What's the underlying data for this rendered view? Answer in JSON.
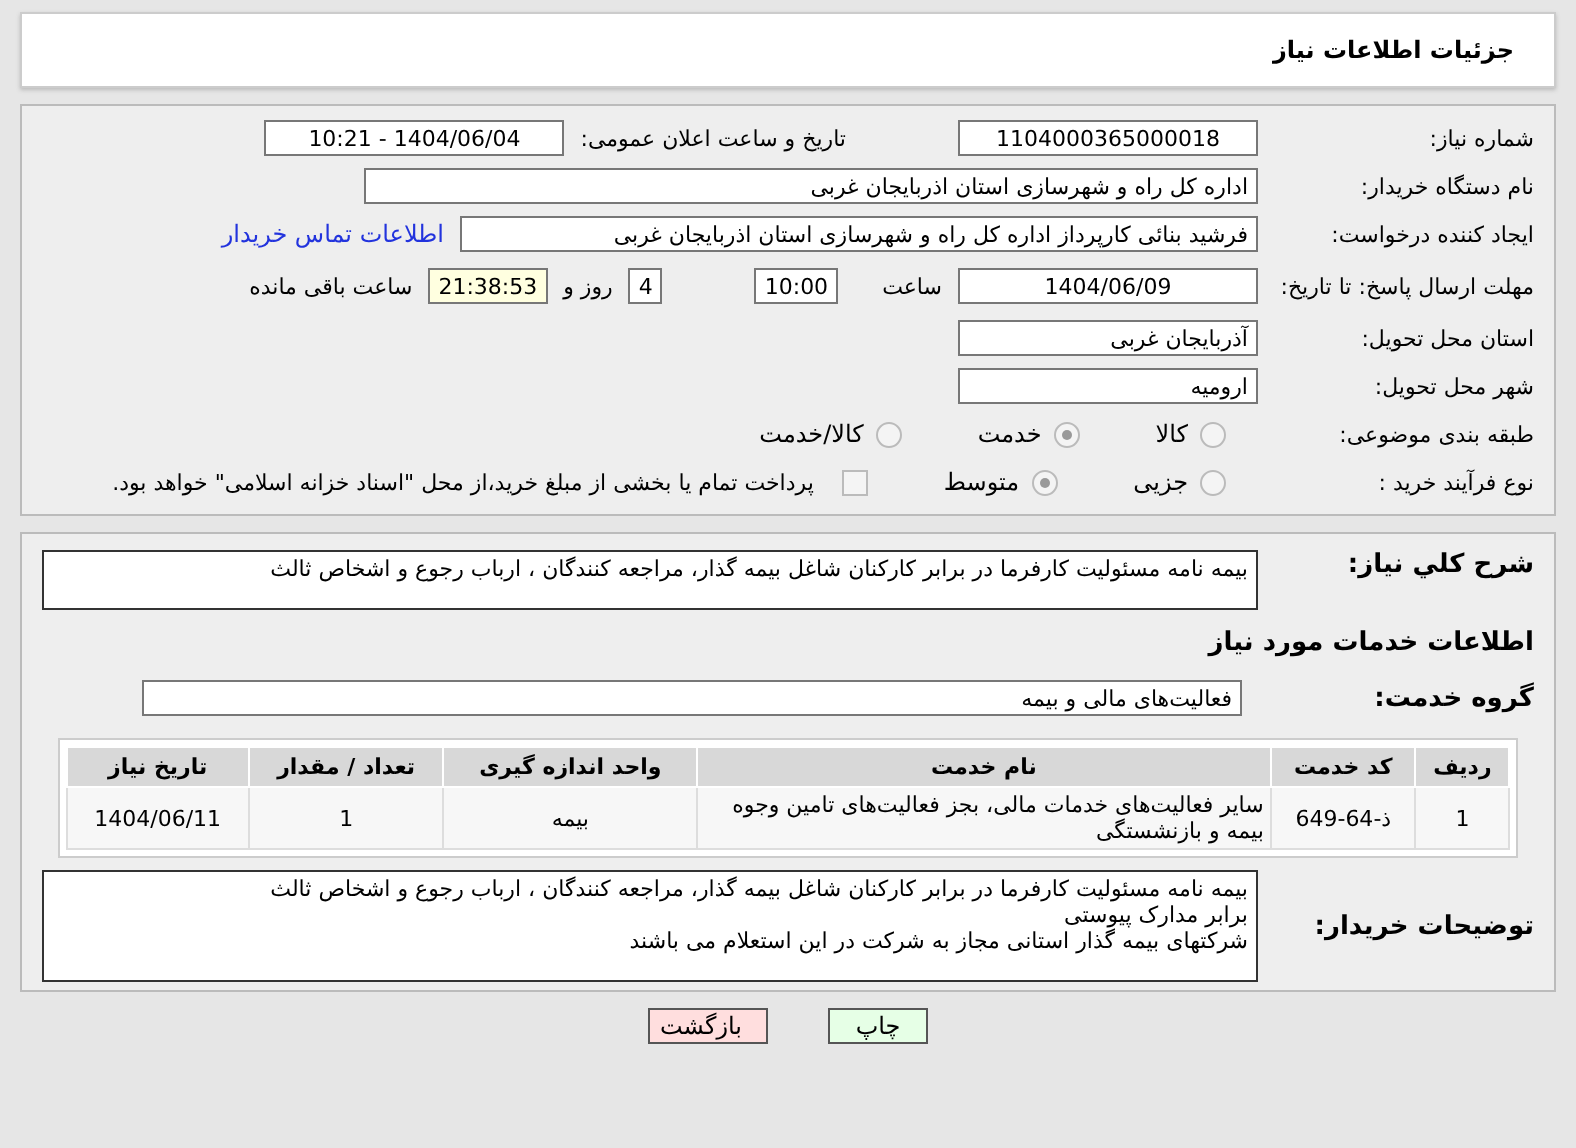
{
  "header": {
    "title": "جزئیات اطلاعات نیاز"
  },
  "need_number": {
    "label": "شماره نیاز:",
    "value": "1104000365000018"
  },
  "announce_date": {
    "label": "تاریخ و ساعت اعلان عمومی:",
    "value": "1404/06/04 - 10:21"
  },
  "buyer_org": {
    "label": "نام دستگاه خریدار:",
    "value": "اداره کل راه و شهرسازی استان اذربایجان غربی"
  },
  "requester": {
    "label": "ایجاد کننده درخواست:",
    "value": "فرشید بنائی کارپرداز اداره کل راه و شهرسازی استان اذربایجان غربی",
    "link": "اطلاعات تماس خریدار"
  },
  "deadline": {
    "label": "مهلت ارسال پاسخ: تا تاریخ:",
    "date": "1404/06/09",
    "time_label": "ساعت",
    "time": "10:00",
    "days": "4",
    "days_label": "روز و",
    "remaining": "21:38:53",
    "remaining_label": "ساعت باقی مانده"
  },
  "province": {
    "label": "استان محل تحویل:",
    "value": "آذربایجان غربی"
  },
  "city": {
    "label": "شهر محل تحویل:",
    "value": "ارومیه"
  },
  "category": {
    "label": "طبقه بندی موضوعی:",
    "options": [
      {
        "label": "کالا",
        "selected": false
      },
      {
        "label": "خدمت",
        "selected": true
      },
      {
        "label": "کالا/خدمت",
        "selected": false
      }
    ]
  },
  "purchase_type": {
    "label": "نوع فرآیند خرید :",
    "options": [
      {
        "label": "جزیی",
        "selected": false
      },
      {
        "label": "متوسط",
        "selected": true
      }
    ],
    "payment_note": {
      "checked": false,
      "text": "پرداخت تمام یا بخشی از مبلغ خرید،از محل \"اسناد خزانه اسلامی\" خواهد بود."
    }
  },
  "summary": {
    "label": "شرح کلي نياز:",
    "value": "بیمه نامه مسئولیت کارفرما در برابر کارکنان شاغل بیمه گذار، مراجعه کنندگان ، ارباب رجوع و اشخاص ثالث"
  },
  "services_heading": "اطلاعات خدمات مورد نیاز",
  "service_group": {
    "label": "گروه خدمت:",
    "value": "فعالیت‌های مالی و بیمه"
  },
  "table": {
    "columns": [
      "ردیف",
      "کد خدمت",
      "نام خدمت",
      "واحد اندازه گیری",
      "تعداد / مقدار",
      "تاریخ نیاز"
    ],
    "rows": [
      [
        "1",
        "ذ-64-649",
        "سایر فعالیت‌های خدمات مالی، بجز فعالیت‌های تامین وجوه بیمه و بازنشستگی",
        "بیمه",
        "1",
        "1404/06/11"
      ]
    ]
  },
  "buyer_notes": {
    "label": "توضیحات خریدار:",
    "lines": [
      "بیمه نامه مسئولیت کارفرما در برابر کارکنان شاغل بیمه گذار، مراجعه کنندگان ، ارباب رجوع و اشخاص ثالث",
      "برابر مدارک پیوستی",
      "شرکتهای بیمه گذار استانی مجاز به شرکت در این استعلام می باشند"
    ]
  },
  "buttons": [
    {
      "kind": "print",
      "label": "چاپ"
    },
    {
      "kind": "back",
      "label": "بازگشت"
    }
  ]
}
